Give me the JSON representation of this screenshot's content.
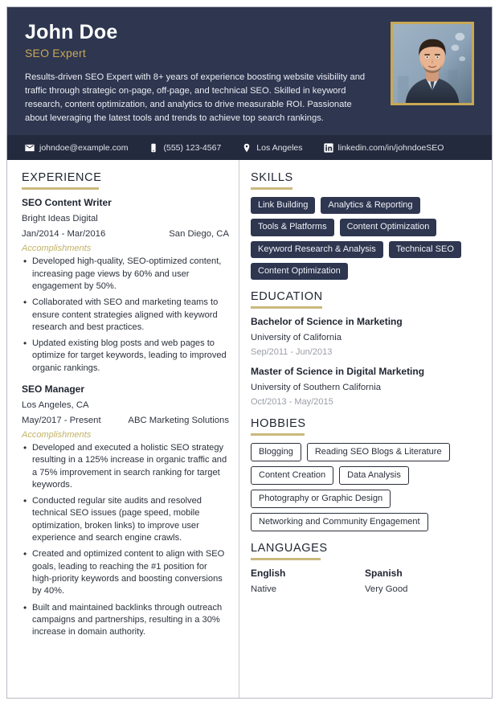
{
  "header": {
    "name": "John Doe",
    "role": "SEO Expert",
    "summary": "Results-driven SEO Expert with 8+ years of experience boosting website visibility and traffic through strategic on-page, off-page, and technical SEO. Skilled in keyword research, content optimization, and analytics to drive measurable ROI. Passionate about leveraging the latest tools and trends to achieve top search rankings.",
    "photo_alt": "profile-photo",
    "accent_gold": "#c8a855",
    "header_bg": "#2e3650",
    "contact_bg": "#232a3d"
  },
  "contact": [
    {
      "icon": "envelope-icon",
      "text": "johndoe@example.com"
    },
    {
      "icon": "mobile-phone-icon",
      "text": "(555) 123-4567"
    },
    {
      "icon": "map-pin-icon",
      "text": "Los Angeles"
    },
    {
      "icon": "linkedin-icon",
      "text": "linkedin.com/in/johndoeSEO"
    }
  ],
  "experience": {
    "title": "EXPERIENCE",
    "jobs": [
      {
        "job_title": "SEO Content Writer",
        "company": "Bright Ideas Digital",
        "dates": "Jan/2014 - Mar/2016",
        "location": "San Diego, CA",
        "accomplishments_label": "Accomplishments",
        "bullets": [
          "Developed high-quality, SEO-optimized content, increasing page views by 60% and user engagement by 50%.",
          "Collaborated with SEO and marketing teams to ensure content strategies aligned with keyword research and best practices.",
          "Updated existing blog posts and web pages to optimize for target keywords, leading to improved organic rankings."
        ]
      },
      {
        "job_title": "SEO Manager",
        "company": "Los Angeles, CA",
        "dates": "May/2017 - Present",
        "location": "ABC Marketing Solutions",
        "accomplishments_label": "Accomplishments",
        "bullets": [
          "Developed and executed a holistic SEO strategy resulting in a 125% increase in organic traffic and a 75% improvement in search ranking for target keywords.",
          "Conducted regular site audits and resolved technical SEO issues (page speed, mobile optimization, broken links) to improve user experience and search engine crawls.",
          "Created and optimized content to align with SEO goals, leading to reaching the #1 position for high-priority keywords and boosting conversions by 40%.",
          "Built and maintained backlinks through outreach campaigns and partnerships, resulting in a 30% increase in domain authority."
        ]
      }
    ]
  },
  "skills": {
    "title": "SKILLS",
    "items": [
      "Link Building",
      "Analytics & Reporting",
      "Tools & Platforms",
      "Content Optimization",
      "Keyword Research & Analysis",
      "Technical SEO",
      "Content Optimization"
    ]
  },
  "education": {
    "title": "EDUCATION",
    "items": [
      {
        "degree": "Bachelor of Science in Marketing",
        "school": "University of California",
        "dates": "Sep/2011 - Jun/2013"
      },
      {
        "degree": "Master of Science in Digital Marketing",
        "school": "University of Southern California",
        "dates": "Oct/2013 - May/2015"
      }
    ]
  },
  "hobbies": {
    "title": "HOBBIES",
    "items": [
      "Blogging",
      "Reading SEO Blogs & Literature",
      "Content Creation",
      "Data Analysis",
      "Photography or Graphic Design",
      "Networking and Community Engagement"
    ]
  },
  "languages": {
    "title": "LANGUAGES",
    "items": [
      {
        "name": "English",
        "level": "Native"
      },
      {
        "name": "Spanish",
        "level": "Very Good"
      }
    ]
  }
}
